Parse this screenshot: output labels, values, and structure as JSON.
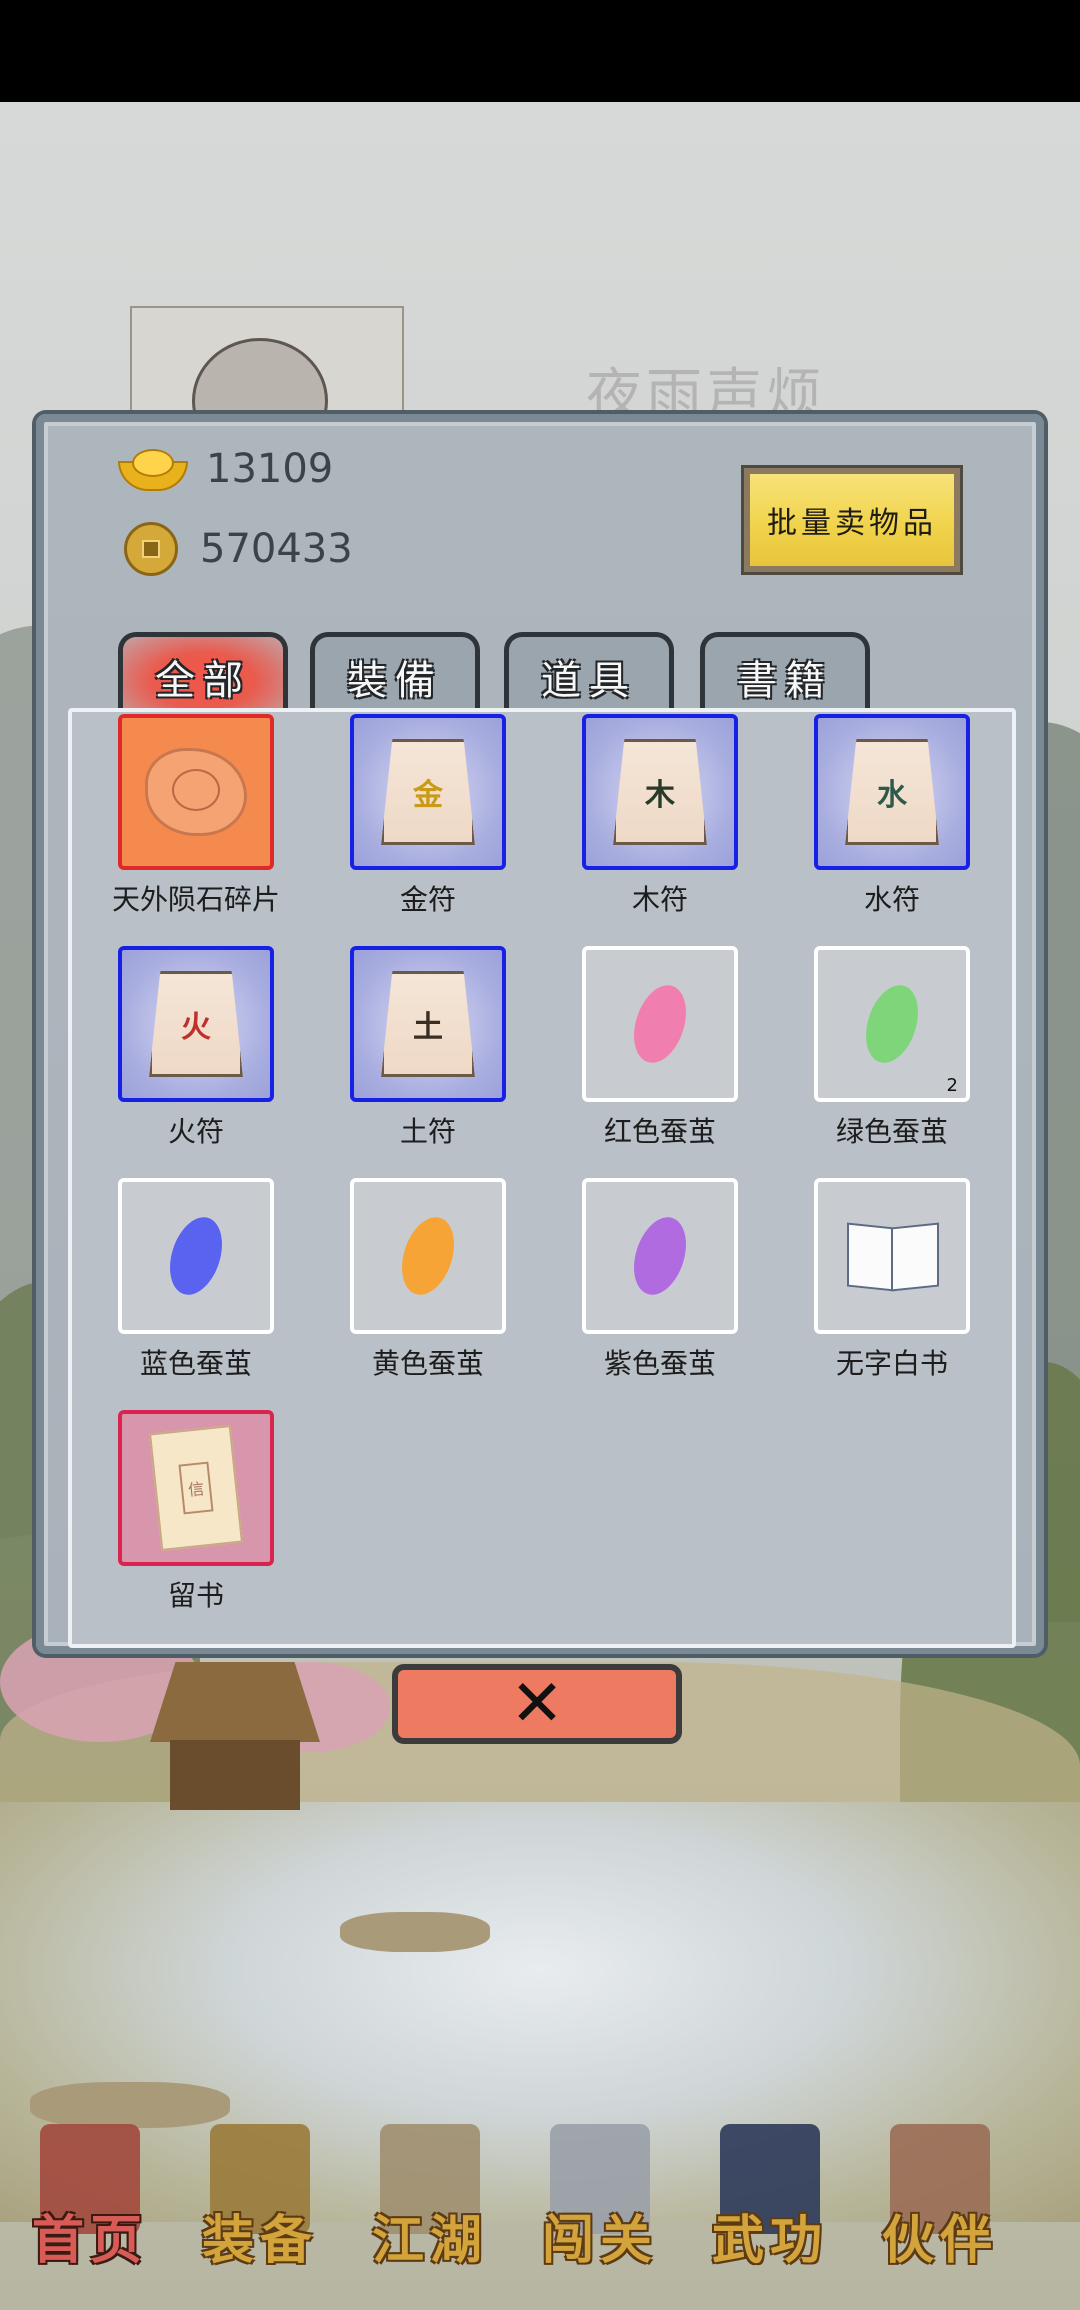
{
  "profile": {
    "name": "夜雨声烦"
  },
  "currency": {
    "gold": "13109",
    "coins": "570433"
  },
  "batch_sell_label": "批量卖物品",
  "tabs": [
    {
      "label": "全部",
      "active": true
    },
    {
      "label": "裝備",
      "active": false
    },
    {
      "label": "道具",
      "active": false
    },
    {
      "label": "書籍",
      "active": false
    }
  ],
  "items": [
    {
      "name": "天外陨石碎片",
      "rarity": "orange",
      "icon": "meteor-fragment-icon",
      "glyph": "",
      "count": ""
    },
    {
      "name": "金符",
      "rarity": "blue",
      "icon": "talisman-icon",
      "glyph": "金",
      "glyph_color": "#c99a16",
      "count": ""
    },
    {
      "name": "木符",
      "rarity": "blue",
      "icon": "talisman-icon",
      "glyph": "木",
      "glyph_color": "#2a3a2a",
      "count": ""
    },
    {
      "name": "水符",
      "rarity": "blue",
      "icon": "talisman-icon",
      "glyph": "水",
      "glyph_color": "#2d5a4a",
      "count": ""
    },
    {
      "name": "火符",
      "rarity": "blue",
      "icon": "talisman-icon",
      "glyph": "火",
      "glyph_color": "#c0302a",
      "count": ""
    },
    {
      "name": "土符",
      "rarity": "blue",
      "icon": "talisman-icon",
      "glyph": "土",
      "glyph_color": "#3a2e22",
      "count": ""
    },
    {
      "name": "红色蚕茧",
      "rarity": "white",
      "icon": "cocoon-icon",
      "color": "#f07fb0",
      "count": ""
    },
    {
      "name": "绿色蚕茧",
      "rarity": "white",
      "icon": "cocoon-icon",
      "color": "#7fd67a",
      "count": "2"
    },
    {
      "name": "蓝色蚕茧",
      "rarity": "white",
      "icon": "cocoon-icon",
      "color": "#5a62f0",
      "count": ""
    },
    {
      "name": "黄色蚕茧",
      "rarity": "white",
      "icon": "cocoon-icon",
      "color": "#f7a437",
      "count": ""
    },
    {
      "name": "紫色蚕茧",
      "rarity": "white",
      "icon": "cocoon-icon",
      "color": "#b06be0",
      "count": ""
    },
    {
      "name": "无字白书",
      "rarity": "white",
      "icon": "book-icon",
      "count": ""
    },
    {
      "name": "留书",
      "rarity": "pink",
      "icon": "letter-icon",
      "glyph": "信",
      "count": ""
    }
  ],
  "close_label": "✕",
  "nav": [
    {
      "label": "首页",
      "icon": "house-icon",
      "active": true,
      "color": "#a2493d"
    },
    {
      "label": "装备",
      "icon": "armor-icon",
      "active": false,
      "color": "#9a7a3a"
    },
    {
      "label": "江湖",
      "icon": "scroll-icon",
      "active": false,
      "color": "#a08f70"
    },
    {
      "label": "闯关",
      "icon": "swords-icon",
      "active": false,
      "color": "#9aa0a8"
    },
    {
      "label": "武功",
      "icon": "manual-icon",
      "active": false,
      "color": "#2d3a5a"
    },
    {
      "label": "伙伴",
      "icon": "partners-icon",
      "active": false,
      "color": "#9a6d55"
    }
  ]
}
